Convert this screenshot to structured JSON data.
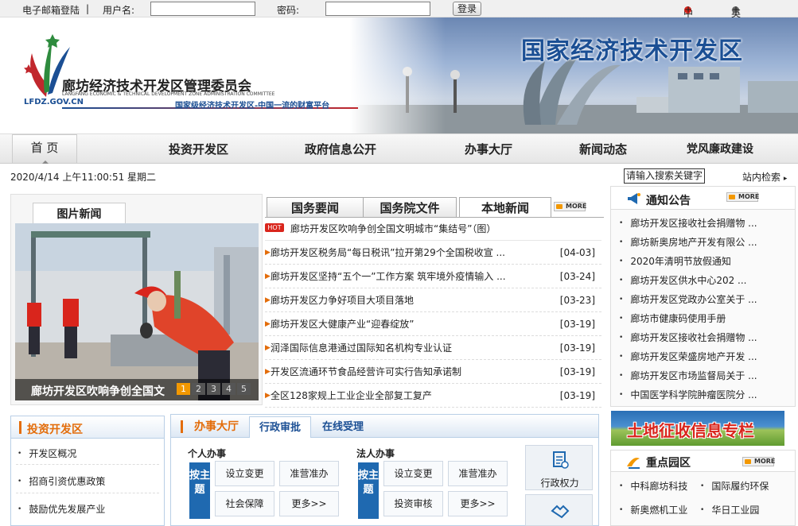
{
  "topbar": {
    "mail_login": "电子邮箱登陆",
    "separator": "|",
    "username_label": "用户名:",
    "username_value": "",
    "password_label": "密码:",
    "password_value": "",
    "login_button": "登录",
    "lang_cn": "中文版",
    "lang_en": "英文版",
    "plus": "+"
  },
  "header": {
    "org_name_cn": "廊坊经济技术开发区管理委员会",
    "org_name_en": "LANGFANG ECONOMIC & TECHNICAL DEVELOPMENT ZONE ADMINISTRATION COMMITTEE",
    "url": "LFDZ.GOV.CN",
    "slogan": "国家级经济技术开发区-中国一流的财富平台",
    "banner_title": "国家经济技术开发区"
  },
  "nav": {
    "items": [
      "首 页",
      "投资开发区",
      "政府信息公开",
      "办事大厅",
      "新闻动态",
      "党风廉政建设"
    ]
  },
  "status": {
    "datetime": "2020/4/14 上午11:00:51 星期二",
    "search_placeholder": "请输入搜索关键字",
    "search_label": "站内检索",
    "search_arrow": "▸"
  },
  "pic_news": {
    "tab": "图片新闻",
    "caption": "廊坊开发区吹响争创全国文",
    "pages": [
      "1",
      "2",
      "3",
      "4",
      "5"
    ],
    "active_page": 1
  },
  "news": {
    "tabs": [
      "国务要闻",
      "国务院文件",
      "本地新闻"
    ],
    "active_tab": 2,
    "more": "MORE",
    "hot_label": "HOT",
    "headline": "廊坊开发区吹响争创全国文明城市“集结号”（图）",
    "items": [
      {
        "title": "廊坊开发区税务局“每日税讯”拉开第29个全国税收宣 ...",
        "date": "[04-03]"
      },
      {
        "title": "廊坊开发区坚持“五个一”工作方案 筑牢境外疫情输入 ...",
        "date": "[03-24]"
      },
      {
        "title": "廊坊开发区力争好项目大项目落地",
        "date": "[03-23]"
      },
      {
        "title": "廊坊开发区大健康产业“迎春绽放”",
        "date": "[03-19]"
      },
      {
        "title": "润泽国际信息港通过国际知名机构专业认证",
        "date": "[03-19]"
      },
      {
        "title": "开发区流通环节食品经营许可实行告知承诺制",
        "date": "[03-19]"
      },
      {
        "title": "全区128家规上工业企业全部复工复产",
        "date": "[03-19]"
      }
    ]
  },
  "notices": {
    "title": "通知公告",
    "more": "MORE",
    "items": [
      "廊坊开发区接收社会捐赠物 ...",
      "廊坊新奥房地产开发有限公 ...",
      "2020年清明节放假通知",
      "廊坊开发区供水中心202 ...",
      "廊坊开发区党政办公室关于 ...",
      "廊坊市健康码使用手册",
      "廊坊开发区接收社会捐赠物 ...",
      "廊坊开发区荣盛房地产开发 ...",
      "廊坊开发区市场监督局关于 ...",
      "中国医学科学院肿瘤医院分 ..."
    ]
  },
  "land_banner": "土地征收信息专栏",
  "parks": {
    "title": "重点园区",
    "more": "MORE",
    "items": [
      "中科廊坊科技",
      "国际履约环保",
      "新奥燃机工业",
      "华日工业园"
    ]
  },
  "invest": {
    "title": "投资开发区",
    "items": [
      "开发区概况",
      "招商引资优惠政策",
      "鼓励优先发展产业"
    ]
  },
  "hall": {
    "tabs": [
      "办事大厅",
      "行政审批",
      "在线受理"
    ],
    "personal": "个人办事",
    "legal": "法人办事",
    "theme": "按主题",
    "personal_services": [
      "设立变更",
      "准营准办",
      "社会保障",
      "更多>>"
    ],
    "legal_services": [
      "设立变更",
      "准营准办",
      "投资审核",
      "更多>>"
    ],
    "power": "行政权力"
  },
  "colors": {
    "brand_blue": "#1b4f94",
    "accent_orange": "#e36c09",
    "hot_red": "#d9251c",
    "theme_blue": "#1f69b0"
  }
}
